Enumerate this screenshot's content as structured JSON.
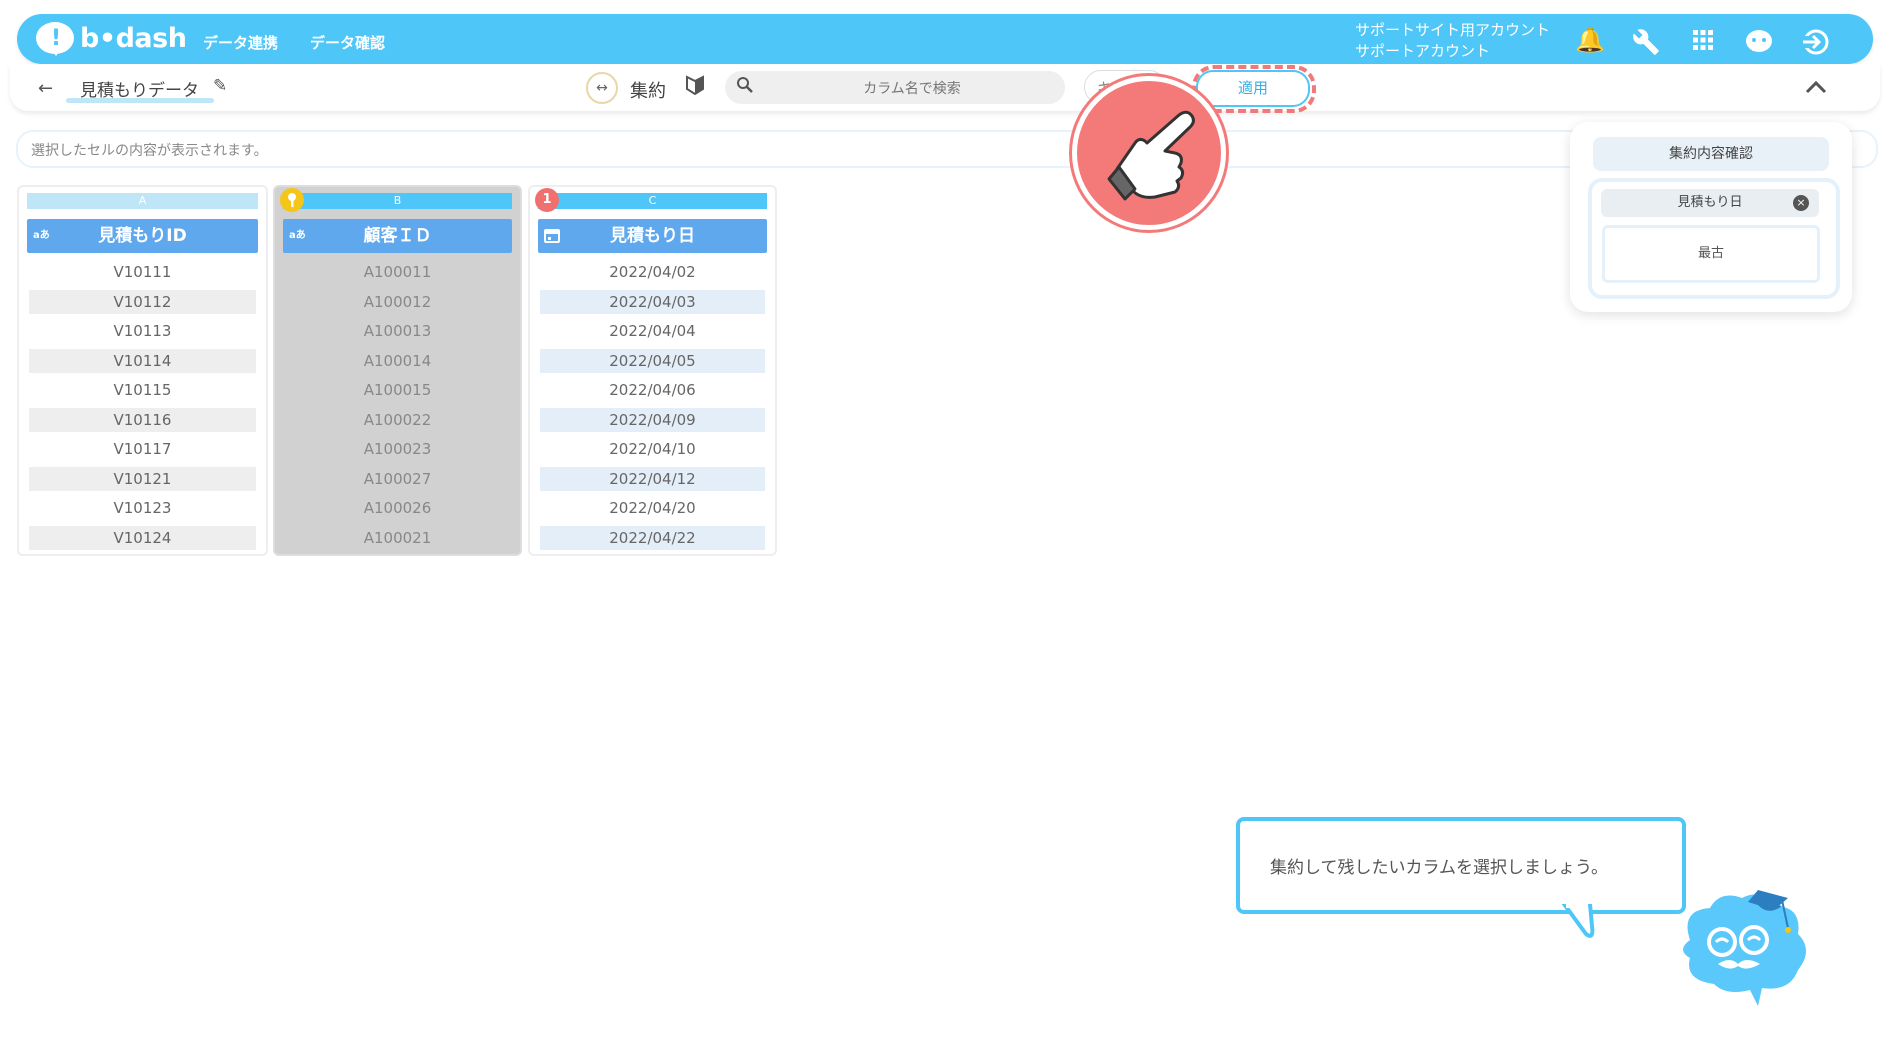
{
  "app": {
    "logo_text": "b•dash",
    "nav": [
      "データ連携",
      "データ確認"
    ],
    "account_line1": "サポートサイト用アカウント",
    "account_line2": "サポートアカウント",
    "colors": {
      "brand": "#4ec6f8",
      "header_blue": "#60a8ee",
      "highlight_red": "#f47a7a",
      "key_yellow": "#f5c518"
    },
    "icons": [
      "bell-icon",
      "wrench-icon",
      "grid-icon",
      "chat-bot-icon",
      "logout-icon"
    ]
  },
  "toolbar": {
    "dataset_title": "見積もりデータ",
    "mode_label": "集約",
    "search_placeholder": "カラム名で検索",
    "cancel_label": "キ",
    "apply_label": "適用"
  },
  "cell_bar": {
    "placeholder": "選択したセルの内容が表示されます。"
  },
  "columns": [
    {
      "letter": "A",
      "type": "aあ",
      "name": "見積もりID",
      "rows": [
        "V10111",
        "V10112",
        "V10113",
        "V10114",
        "V10115",
        "V10116",
        "V10117",
        "V10121",
        "V10123",
        "V10124"
      ]
    },
    {
      "letter": "B",
      "type": "aあ",
      "name": "顧客ＩＤ",
      "rows": [
        "A100011",
        "A100012",
        "A100013",
        "A100014",
        "A100015",
        "A100022",
        "A100023",
        "A100027",
        "A100026",
        "A100021"
      ]
    },
    {
      "letter": "C",
      "type": "",
      "name": "見積もり日",
      "badge": "1",
      "rows": [
        "2022/04/02",
        "2022/04/03",
        "2022/04/04",
        "2022/04/05",
        "2022/04/06",
        "2022/04/09",
        "2022/04/10",
        "2022/04/12",
        "2022/04/20",
        "2022/04/22"
      ]
    }
  ],
  "panel": {
    "title": "集約内容確認",
    "chip": "見積もり日",
    "option": "最古"
  },
  "tutorial": {
    "message": "集約して残したいカラムを選択しましょう。"
  }
}
